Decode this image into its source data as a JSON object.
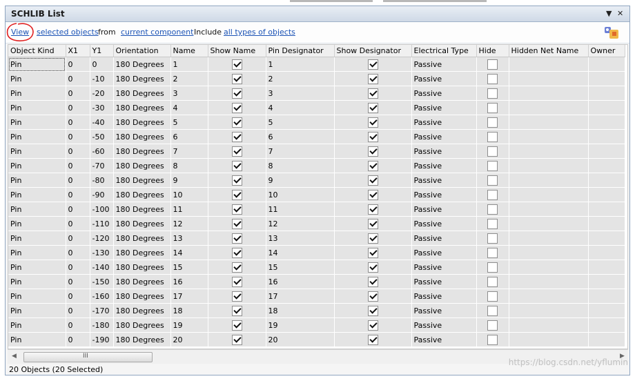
{
  "panel": {
    "title": "SCHLIB List",
    "menu_icon": "dropdown-triangle-icon",
    "close_icon": "close-x-icon"
  },
  "toolbar": {
    "view_label": "View",
    "selected_label": "selected objects",
    "from_label": "from",
    "component_label": "current component",
    "include_label": "Include",
    "types_label": "all types of objects",
    "tool_icon": "inspector-tool-icon"
  },
  "table": {
    "headers": [
      "Object Kind",
      "X1",
      "Y1",
      "Orientation",
      "Name",
      "Show Name",
      "Pin Designator",
      "Show Designator",
      "Electrical Type",
      "Hide",
      "Hidden Net Name",
      "Owner"
    ],
    "rows": [
      {
        "kind": "Pin",
        "x1": "0",
        "y1": "0",
        "orient": "180 Degrees",
        "name": "1",
        "show_name": true,
        "designator": "1",
        "show_designator": true,
        "etype": "Passive",
        "hide": false,
        "hnet": "",
        "owner": ""
      },
      {
        "kind": "Pin",
        "x1": "0",
        "y1": "-10",
        "orient": "180 Degrees",
        "name": "2",
        "show_name": true,
        "designator": "2",
        "show_designator": true,
        "etype": "Passive",
        "hide": false,
        "hnet": "",
        "owner": ""
      },
      {
        "kind": "Pin",
        "x1": "0",
        "y1": "-20",
        "orient": "180 Degrees",
        "name": "3",
        "show_name": true,
        "designator": "3",
        "show_designator": true,
        "etype": "Passive",
        "hide": false,
        "hnet": "",
        "owner": ""
      },
      {
        "kind": "Pin",
        "x1": "0",
        "y1": "-30",
        "orient": "180 Degrees",
        "name": "4",
        "show_name": true,
        "designator": "4",
        "show_designator": true,
        "etype": "Passive",
        "hide": false,
        "hnet": "",
        "owner": ""
      },
      {
        "kind": "Pin",
        "x1": "0",
        "y1": "-40",
        "orient": "180 Degrees",
        "name": "5",
        "show_name": true,
        "designator": "5",
        "show_designator": true,
        "etype": "Passive",
        "hide": false,
        "hnet": "",
        "owner": ""
      },
      {
        "kind": "Pin",
        "x1": "0",
        "y1": "-50",
        "orient": "180 Degrees",
        "name": "6",
        "show_name": true,
        "designator": "6",
        "show_designator": true,
        "etype": "Passive",
        "hide": false,
        "hnet": "",
        "owner": ""
      },
      {
        "kind": "Pin",
        "x1": "0",
        "y1": "-60",
        "orient": "180 Degrees",
        "name": "7",
        "show_name": true,
        "designator": "7",
        "show_designator": true,
        "etype": "Passive",
        "hide": false,
        "hnet": "",
        "owner": ""
      },
      {
        "kind": "Pin",
        "x1": "0",
        "y1": "-70",
        "orient": "180 Degrees",
        "name": "8",
        "show_name": true,
        "designator": "8",
        "show_designator": true,
        "etype": "Passive",
        "hide": false,
        "hnet": "",
        "owner": ""
      },
      {
        "kind": "Pin",
        "x1": "0",
        "y1": "-80",
        "orient": "180 Degrees",
        "name": "9",
        "show_name": true,
        "designator": "9",
        "show_designator": true,
        "etype": "Passive",
        "hide": false,
        "hnet": "",
        "owner": ""
      },
      {
        "kind": "Pin",
        "x1": "0",
        "y1": "-90",
        "orient": "180 Degrees",
        "name": "10",
        "show_name": true,
        "designator": "10",
        "show_designator": true,
        "etype": "Passive",
        "hide": false,
        "hnet": "",
        "owner": ""
      },
      {
        "kind": "Pin",
        "x1": "0",
        "y1": "-100",
        "orient": "180 Degrees",
        "name": "11",
        "show_name": true,
        "designator": "11",
        "show_designator": true,
        "etype": "Passive",
        "hide": false,
        "hnet": "",
        "owner": ""
      },
      {
        "kind": "Pin",
        "x1": "0",
        "y1": "-110",
        "orient": "180 Degrees",
        "name": "12",
        "show_name": true,
        "designator": "12",
        "show_designator": true,
        "etype": "Passive",
        "hide": false,
        "hnet": "",
        "owner": ""
      },
      {
        "kind": "Pin",
        "x1": "0",
        "y1": "-120",
        "orient": "180 Degrees",
        "name": "13",
        "show_name": true,
        "designator": "13",
        "show_designator": true,
        "etype": "Passive",
        "hide": false,
        "hnet": "",
        "owner": ""
      },
      {
        "kind": "Pin",
        "x1": "0",
        "y1": "-130",
        "orient": "180 Degrees",
        "name": "14",
        "show_name": true,
        "designator": "14",
        "show_designator": true,
        "etype": "Passive",
        "hide": false,
        "hnet": "",
        "owner": ""
      },
      {
        "kind": "Pin",
        "x1": "0",
        "y1": "-140",
        "orient": "180 Degrees",
        "name": "15",
        "show_name": true,
        "designator": "15",
        "show_designator": true,
        "etype": "Passive",
        "hide": false,
        "hnet": "",
        "owner": ""
      },
      {
        "kind": "Pin",
        "x1": "0",
        "y1": "-150",
        "orient": "180 Degrees",
        "name": "16",
        "show_name": true,
        "designator": "16",
        "show_designator": true,
        "etype": "Passive",
        "hide": false,
        "hnet": "",
        "owner": ""
      },
      {
        "kind": "Pin",
        "x1": "0",
        "y1": "-160",
        "orient": "180 Degrees",
        "name": "17",
        "show_name": true,
        "designator": "17",
        "show_designator": true,
        "etype": "Passive",
        "hide": false,
        "hnet": "",
        "owner": ""
      },
      {
        "kind": "Pin",
        "x1": "0",
        "y1": "-170",
        "orient": "180 Degrees",
        "name": "18",
        "show_name": true,
        "designator": "18",
        "show_designator": true,
        "etype": "Passive",
        "hide": false,
        "hnet": "",
        "owner": ""
      },
      {
        "kind": "Pin",
        "x1": "0",
        "y1": "-180",
        "orient": "180 Degrees",
        "name": "19",
        "show_name": true,
        "designator": "19",
        "show_designator": true,
        "etype": "Passive",
        "hide": false,
        "hnet": "",
        "owner": ""
      },
      {
        "kind": "Pin",
        "x1": "0",
        "y1": "-190",
        "orient": "180 Degrees",
        "name": "20",
        "show_name": true,
        "designator": "20",
        "show_designator": true,
        "etype": "Passive",
        "hide": false,
        "hnet": "",
        "owner": ""
      }
    ]
  },
  "scrollbar": {
    "grip_glyph": "III"
  },
  "status": {
    "text": "20 Objects (20 Selected)"
  },
  "watermark": "https://blog.csdn.net/yflumin",
  "colors": {
    "link": "#1a52b5",
    "cell_bg": "#e4e4e4",
    "annotation_red": "#e02020"
  }
}
